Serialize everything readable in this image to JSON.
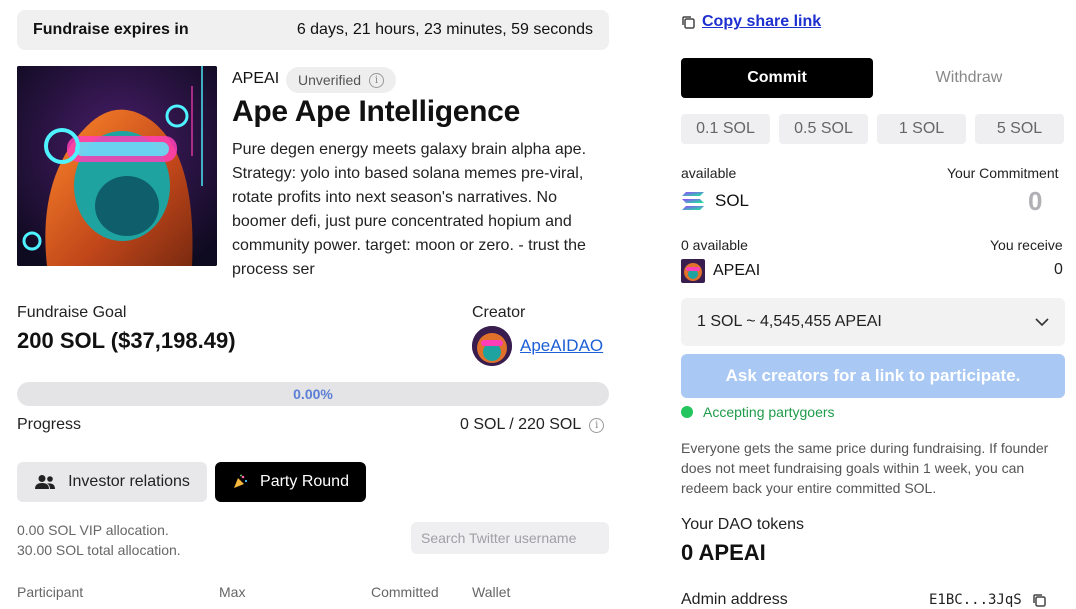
{
  "fundraise": {
    "expires_label": "Fundraise expires in",
    "expires_value": "6 days, 21 hours, 23 minutes, 59 seconds"
  },
  "token": {
    "ticker": "APEAI",
    "badge": "Unverified",
    "name": "Ape Ape Intelligence",
    "description": "Pure degen energy meets galaxy brain alpha ape. Strategy: yolo into based solana memes pre-viral, rotate profits into next season's narratives. No boomer defi, just pure concentrated hopium and community power. target: moon or zero. - trust the process ser"
  },
  "goal": {
    "label": "Fundraise Goal",
    "value": "200 SOL ($37,198.49)"
  },
  "creator": {
    "label": "Creator",
    "name": "ApeAIDAO"
  },
  "progress": {
    "fraction": 0.0,
    "percent_text": "0.00%",
    "label": "Progress",
    "value": "0 SOL / 220 SOL"
  },
  "tabs": {
    "investor": "Investor relations",
    "party": "Party Round"
  },
  "allocation": {
    "vip": "0.00 SOL VIP allocation.",
    "total": "30.00 SOL total allocation."
  },
  "search": {
    "placeholder": "Search Twitter username"
  },
  "table": {
    "headers": [
      "Participant",
      "Max",
      "Committed",
      "Wallet"
    ]
  },
  "share": {
    "label": "Copy share link"
  },
  "trade": {
    "commit": "Commit",
    "withdraw": "Withdraw",
    "amounts": [
      "0.1 SOL",
      "0.5 SOL",
      "1 SOL",
      "5 SOL"
    ],
    "available_label": "available",
    "commitment_label": "Your Commitment",
    "pay_token": "SOL",
    "commitment_value": "0",
    "receive_available": "0 available",
    "receive_label": "You receive",
    "receive_token": "APEAI",
    "receive_value": "0",
    "rate": "1 SOL ~ 4,545,455 APEAI",
    "ask_button": "Ask creators for a link to participate.",
    "status": "Accepting partygoers",
    "notice": "Everyone gets the same price during fundraising. If founder does not meet fundraising goals within 1 week, you can redeem back your entire committed SOL."
  },
  "dao": {
    "label": "Your DAO tokens",
    "value": "0 APEAI",
    "admin_label": "Admin address",
    "admin_value": "E1BC...3JqS"
  },
  "colors": {
    "accent_black": "#000000",
    "link_blue": "#1d5fd6",
    "disabled_button": "#a9c8f3",
    "status_green": "#22c55e"
  }
}
